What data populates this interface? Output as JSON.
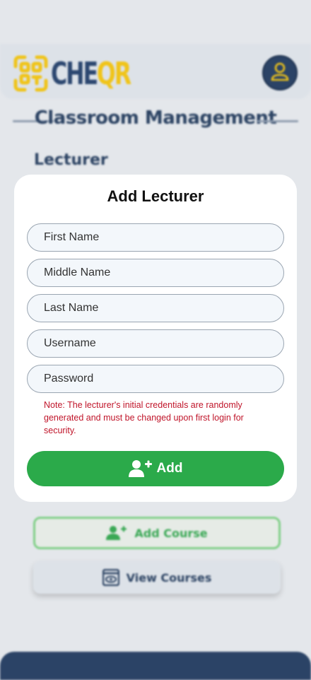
{
  "app": {
    "logo_che": "CHE",
    "logo_qr": "QR",
    "section_title": "Classroom Management",
    "subsection": "Lecturer"
  },
  "modal": {
    "title": "Add Lecturer",
    "fields": {
      "first_name": "First Name",
      "middle_name": "Middle Name",
      "last_name": "Last Name",
      "username": "Username",
      "password": "Password"
    },
    "note": "Note: The lecturer's initial credentials are randomly generated and must be changed upon first login for security.",
    "add_label": "Add"
  },
  "background_buttons": {
    "add_course": "Add Course",
    "view_courses": "View Courses"
  },
  "icons": {
    "logo": "qr-scan-icon",
    "profile": "user-icon",
    "add_user": "user-plus-icon",
    "view": "eye-window-icon"
  },
  "colors": {
    "brand_navy": "#2c4363",
    "brand_yellow": "#f0c419",
    "primary_green": "#2baa4a",
    "note_red": "#c0152a"
  }
}
